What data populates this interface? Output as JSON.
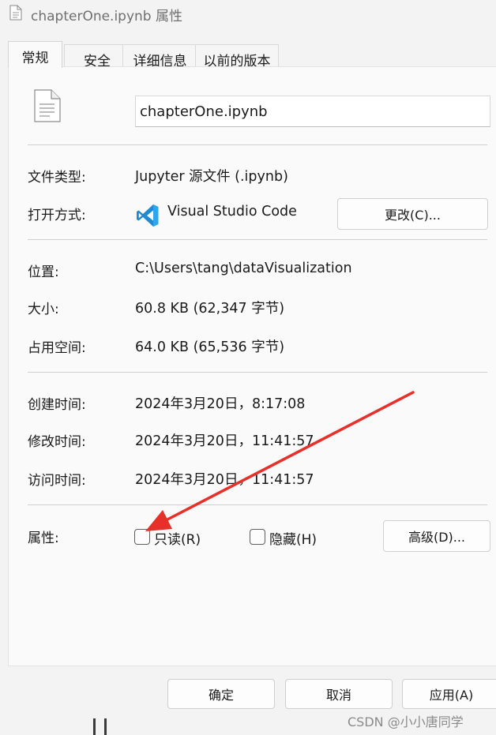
{
  "window": {
    "title": "chapterOne.ipynb 属性"
  },
  "tabs": [
    {
      "label": "常规"
    },
    {
      "label": "安全"
    },
    {
      "label": "详细信息"
    },
    {
      "label": "以前的版本"
    }
  ],
  "general": {
    "file_name": "chapterOne.ipynb",
    "type_label": "文件类型:",
    "type_value": "Jupyter 源文件 (.ipynb)",
    "opens_label": "打开方式:",
    "opens_value": "Visual Studio Code",
    "change_button": "更改(C)...",
    "location_label": "位置:",
    "location_value": "C:\\Users\\tang\\dataVisualization",
    "size_label": "大小:",
    "size_value": "60.8 KB (62,347 字节)",
    "size_on_disk_label": "占用空间:",
    "size_on_disk_value": "64.0 KB (65,536 字节)",
    "created_label": "创建时间:",
    "created_value": "2024年3月20日，8:17:08",
    "modified_label": "修改时间:",
    "modified_value": "2024年3月20日，11:41:57",
    "accessed_label": "访问时间:",
    "accessed_value": "2024年3月20日，11:41:57",
    "attributes_label": "属性:",
    "readonly_label": "只读(R)",
    "hidden_label": "隐藏(H)",
    "advanced_button": "高级(D)..."
  },
  "footer": {
    "ok_button": "确定",
    "cancel_button": "取消",
    "apply_button": "应用(A)"
  },
  "watermark": "CSDN @小小唐同学",
  "colors": {
    "arrow": "#e8302a",
    "vscode_blue": "#1f8ad2"
  }
}
